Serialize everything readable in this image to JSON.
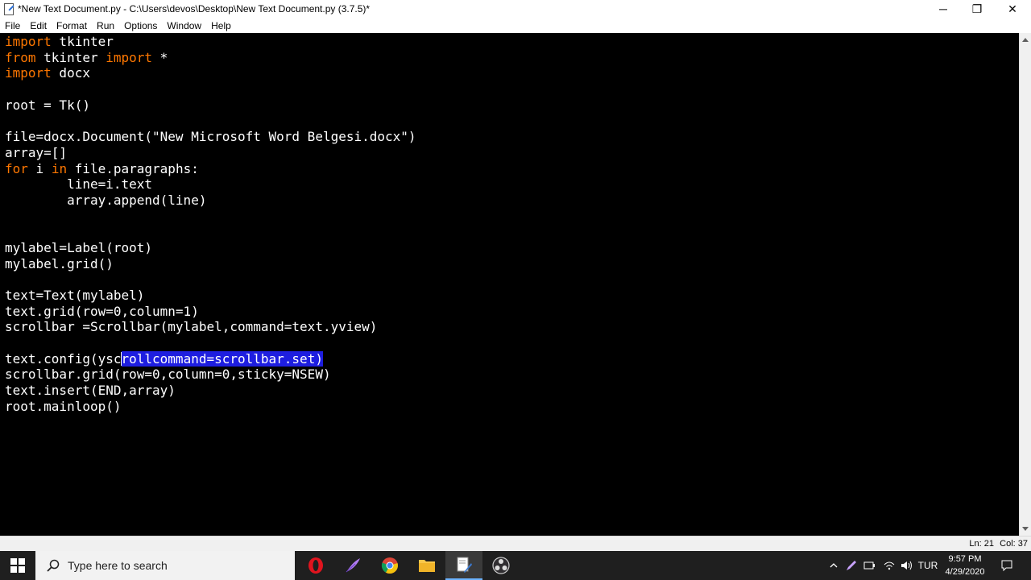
{
  "window": {
    "title": "*New Text Document.py - C:\\Users\\devos\\Desktop\\New Text Document.py (3.7.5)*",
    "minimize": "─",
    "maximize": "❐",
    "close": "✕"
  },
  "menu": [
    "File",
    "Edit",
    "Format",
    "Run",
    "Options",
    "Window",
    "Help"
  ],
  "editor": {
    "background": "#000000",
    "keyword_color": "#ff7700",
    "lines": [
      [
        {
          "t": "import",
          "k": 1
        },
        {
          "t": " tkinter"
        }
      ],
      [
        {
          "t": "from",
          "k": 1
        },
        {
          "t": " tkinter "
        },
        {
          "t": "import",
          "k": 1
        },
        {
          "t": " *"
        }
      ],
      [
        {
          "t": "import",
          "k": 1
        },
        {
          "t": " docx"
        }
      ],
      [],
      [
        {
          "t": "root = Tk()"
        }
      ],
      [],
      [
        {
          "t": "file=docx.Document(\"New Microsoft Word Belgesi.docx\")"
        }
      ],
      [
        {
          "t": "array=[]"
        }
      ],
      [
        {
          "t": "for",
          "k": 1
        },
        {
          "t": " i "
        },
        {
          "t": "in",
          "k": 1
        },
        {
          "t": " file.paragraphs:"
        }
      ],
      [
        {
          "t": "        line=i.text"
        }
      ],
      [
        {
          "t": "        array.append(line)"
        }
      ],
      [],
      [],
      [
        {
          "t": "mylabel=Label(root)"
        }
      ],
      [
        {
          "t": "mylabel.grid()"
        }
      ],
      [],
      [
        {
          "t": "text=Text(mylabel)"
        }
      ],
      [
        {
          "t": "text.grid(row=0,column=1)"
        }
      ],
      [
        {
          "t": "scrollbar =Scrollbar(mylabel,command=text.yview)"
        }
      ],
      [],
      [
        {
          "t": "text.config(ysc"
        },
        {
          "cursor": 1
        },
        {
          "t": "rollcommand=scrollbar.set)",
          "s": 1
        }
      ],
      [
        {
          "t": "scrollbar.grid(row=0,column=0,sticky=NSEW)"
        }
      ],
      [
        {
          "t": "text.insert(END,array)"
        }
      ],
      [
        {
          "t": "root.mainloop()"
        }
      ]
    ]
  },
  "status": {
    "line": "Ln: 21",
    "col": "Col: 37"
  },
  "taskbar": {
    "search_placeholder": "Type here to search",
    "language": "TUR",
    "time": "9:57 PM",
    "date": "4/29/2020"
  }
}
